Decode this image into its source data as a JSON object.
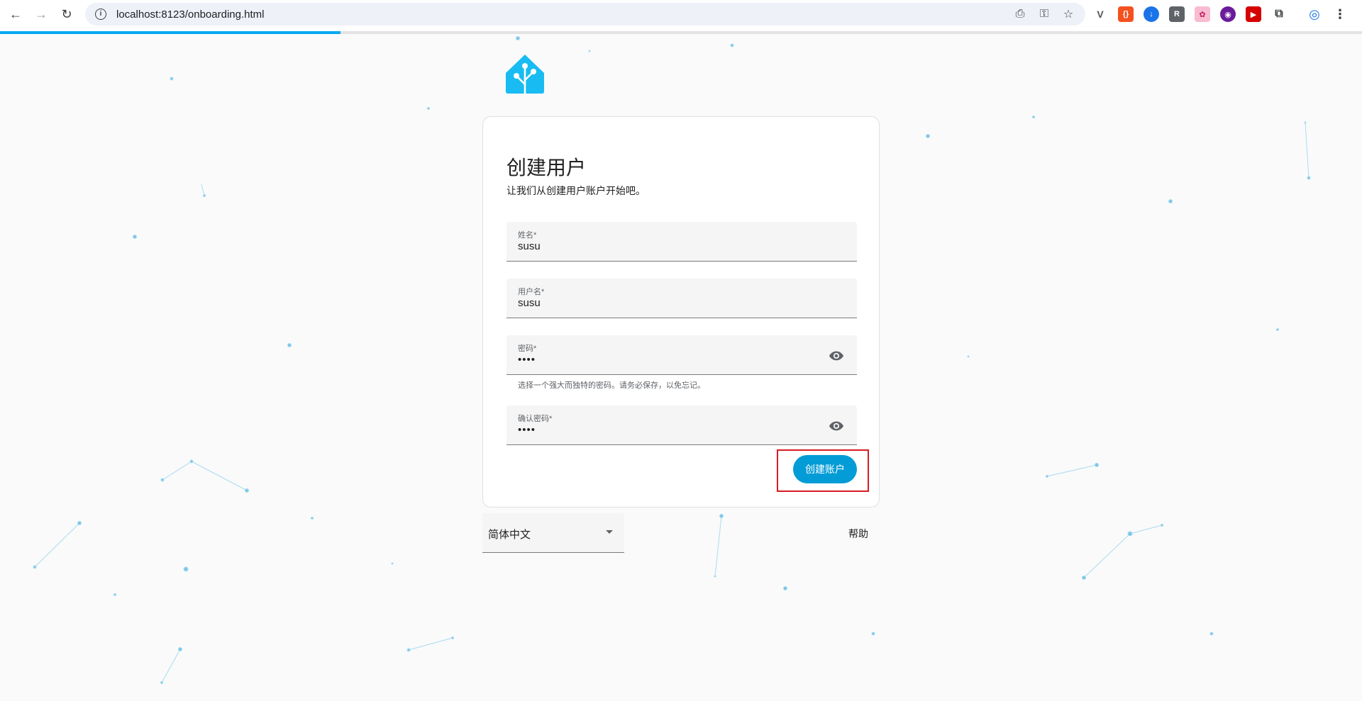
{
  "browser": {
    "url": "localhost:8123/onboarding.html",
    "progress_percent": 25
  },
  "card": {
    "title": "创建用户",
    "subtitle": "让我们从创建用户账户开始吧。"
  },
  "fields": {
    "name": {
      "label": "姓名*",
      "value": "susu"
    },
    "username": {
      "label": "用户名*",
      "value": "susu"
    },
    "password": {
      "label": "密码*",
      "value": "••••",
      "helper": "选择一个强大而独特的密码。请务必保存，以免忘记。"
    },
    "confirm": {
      "label": "确认密码*",
      "value": "••••"
    }
  },
  "actions": {
    "create_label": "创建账户"
  },
  "footer": {
    "language": "简体中文",
    "help_label": "帮助"
  },
  "colors": {
    "accent": "#039cd6",
    "highlight": "#d81b22",
    "logo": "#18bcf2"
  }
}
